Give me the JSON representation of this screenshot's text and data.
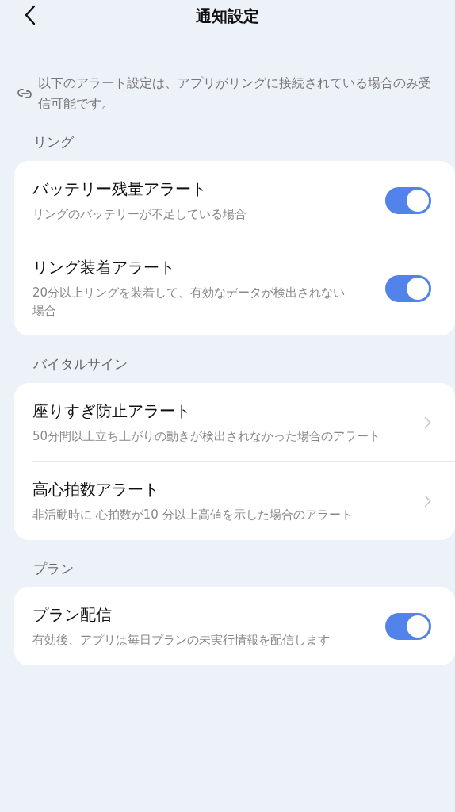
{
  "header": {
    "title": "通知設定"
  },
  "notice": "以下のアラート設定は、アプリがリングに接続されている場合のみ受信可能です。",
  "sections": [
    {
      "label": "リング",
      "items": [
        {
          "kind": "toggle",
          "title": "バッテリー残量アラート",
          "description": "リングのバッテリーが不足している場合",
          "on": true
        },
        {
          "kind": "toggle",
          "title": "リング装着アラート",
          "description": "20分以上リングを装着して、有効なデータが検出されない場合",
          "on": true
        }
      ]
    },
    {
      "label": "バイタルサイン",
      "items": [
        {
          "kind": "link",
          "title": "座りすぎ防止アラート",
          "description": "50分間以上立ち上がりの動きが検出されなかった場合のアラート"
        },
        {
          "kind": "link",
          "title": "高心拍数アラート",
          "description": "非活動時に 心拍数が10 分以上高値を示した場合のアラート"
        }
      ]
    },
    {
      "label": "プラン",
      "items": [
        {
          "kind": "toggle",
          "title": "プラン配信",
          "description": "有効後、アプリは毎日プランの未実行情報を配信します",
          "on": true
        }
      ]
    }
  ]
}
